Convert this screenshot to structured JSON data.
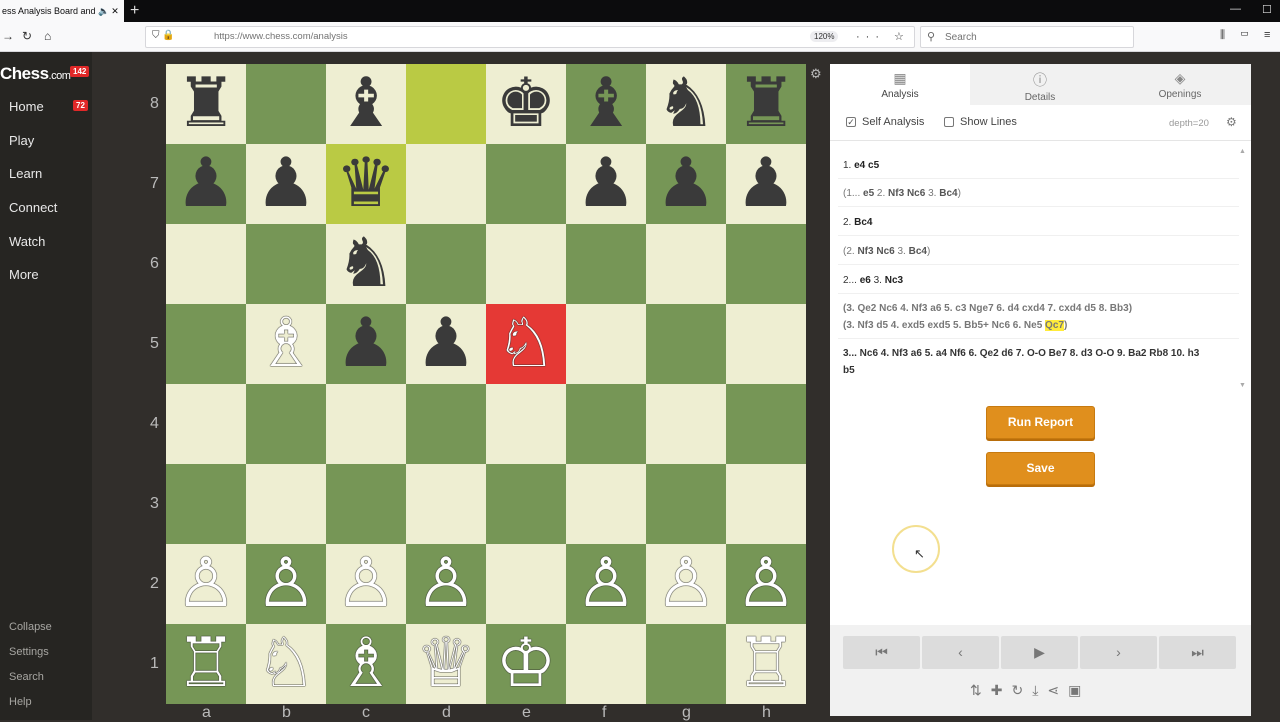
{
  "browser": {
    "tab_title": "ess Analysis Board and P",
    "url": "https://www.chess.com/analysis",
    "zoom": "120%",
    "search_placeholder": "Search"
  },
  "sidebar": {
    "logo": "Chess",
    "logo_suffix": ".com",
    "logo_badge": "142",
    "items": [
      {
        "label": "Home",
        "badge": "72"
      },
      {
        "label": "Play"
      },
      {
        "label": "Learn"
      },
      {
        "label": "Connect"
      },
      {
        "label": "Watch"
      },
      {
        "label": "More"
      }
    ],
    "bottom": [
      "Collapse",
      "Settings",
      "Search",
      "Help"
    ]
  },
  "board": {
    "ranks": [
      "8",
      "7",
      "6",
      "5",
      "4",
      "3",
      "2",
      "1"
    ],
    "files": [
      "a",
      "b",
      "c",
      "d",
      "e",
      "f",
      "g",
      "h"
    ],
    "light_color": "#eeeed2",
    "dark_color": "#769656",
    "highlight_color": "#baca44",
    "check_color": "#e53935",
    "pieces": [
      [
        "♜",
        "",
        "♝",
        "",
        "♚",
        "♝",
        "♞",
        "♜"
      ],
      [
        "♟",
        "♟",
        "♛",
        "",
        "",
        "♟",
        "♟",
        "♟"
      ],
      [
        "",
        "",
        "♞",
        "",
        "",
        "",
        "",
        ""
      ],
      [
        "",
        "♗",
        "♟",
        "♟",
        "♘",
        "",
        "",
        ""
      ],
      [
        "",
        "",
        "",
        "",
        "",
        "",
        "",
        ""
      ],
      [
        "",
        "",
        "",
        "",
        "",
        "",
        "",
        ""
      ],
      [
        "♙",
        "♙",
        "♙",
        "♙",
        "",
        "♙",
        "♙",
        "♙"
      ],
      [
        "♖",
        "♘",
        "♗",
        "♕",
        "♔",
        "",
        "",
        "♖"
      ]
    ]
  },
  "panel": {
    "tabs": [
      {
        "label": "Analysis",
        "icon": "analysis-icon"
      },
      {
        "label": "Details",
        "icon": "info-icon"
      },
      {
        "label": "Openings",
        "icon": "book-icon"
      }
    ],
    "self_analysis": "Self Analysis",
    "show_lines": "Show Lines",
    "depth": "depth=20",
    "moves": {
      "l1_num": "1.",
      "l1_a": "e4",
      "l1_b": "c5",
      "l2_a": "(1...",
      "l2_b": "e5",
      "l2_c": "2.",
      "l2_d": "Nf3",
      "l2_e": "Nc6",
      "l2_f": "3.",
      "l2_g": "Bc4",
      "l2_h": ")",
      "l3_num": "2.",
      "l3_a": "Bc4",
      "l4_a": "(2.",
      "l4_b": "Nf3",
      "l4_c": "Nc6",
      "l4_d": "3.",
      "l4_e": "Bc4",
      "l4_f": ")",
      "l5_num": "2...",
      "l5_a": "e6",
      "l5_b": "3.",
      "l5_c": "Nc3",
      "l6": "(3. Qe2 Nc6 4. Nf3 a6 5. c3 Nge7 6. d4 cxd4 7. cxd4 d5 8. Bb3)",
      "l7_a": "(3. Nf3 d5 4. exd5 exd5 5. Bb5+ Nc6 6. Ne5",
      "l7_hl": "Qc7",
      "l7_end": ")",
      "l8": "3... Nc6 4. Nf3 a6 5. a4 Nf6 6. Qe2 d6 7. O-O Be7 8. d3 O-O 9. Ba2 Rb8 10. h3",
      "l9": "b5"
    },
    "run_report": "Run Report",
    "save": "Save",
    "accent_color": "#e08f1d"
  }
}
